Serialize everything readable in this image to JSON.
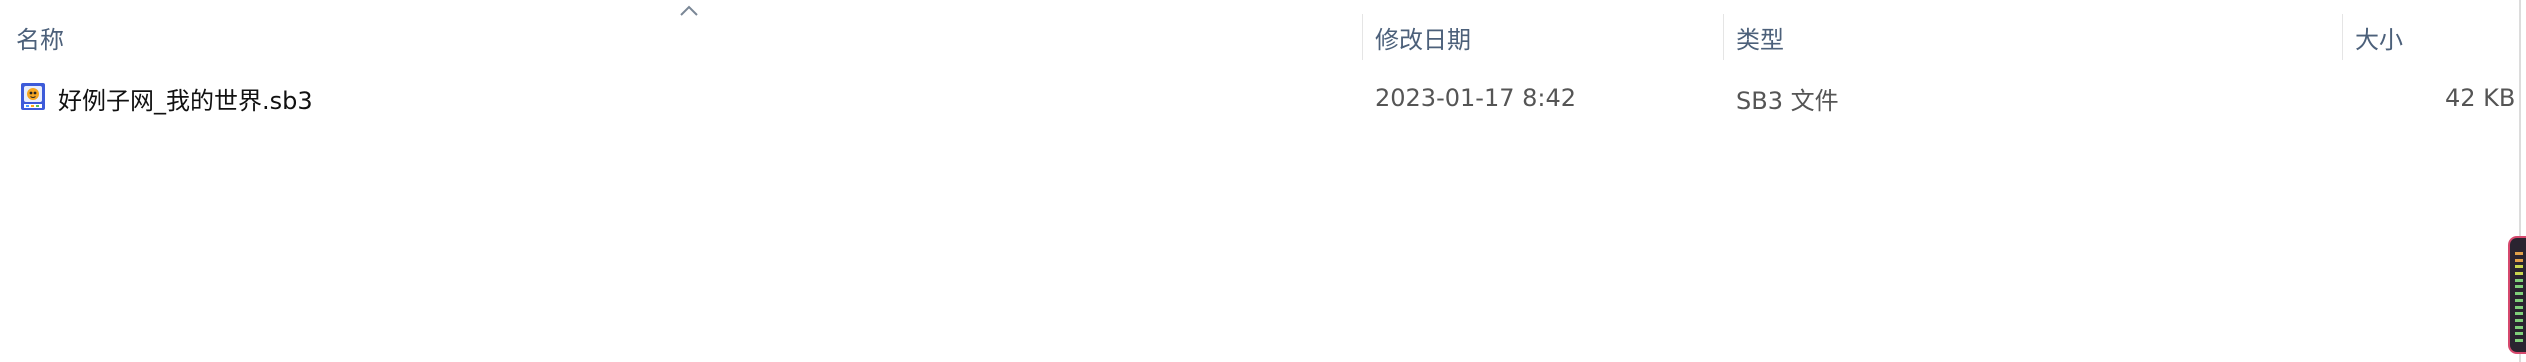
{
  "columns": {
    "name": "名称",
    "modified": "修改日期",
    "type": "类型",
    "size": "大小"
  },
  "sort": {
    "column": "name",
    "direction": "ascending"
  },
  "files": [
    {
      "name": "好例子网_我的世界.sb3",
      "modified": "2023-01-17 8:42",
      "type": "SB3 文件",
      "size": "42 KB",
      "icon": "scratch-file-icon"
    }
  ],
  "colors": {
    "header_text": "#4c607a",
    "gadget_border": "#d6486d"
  }
}
